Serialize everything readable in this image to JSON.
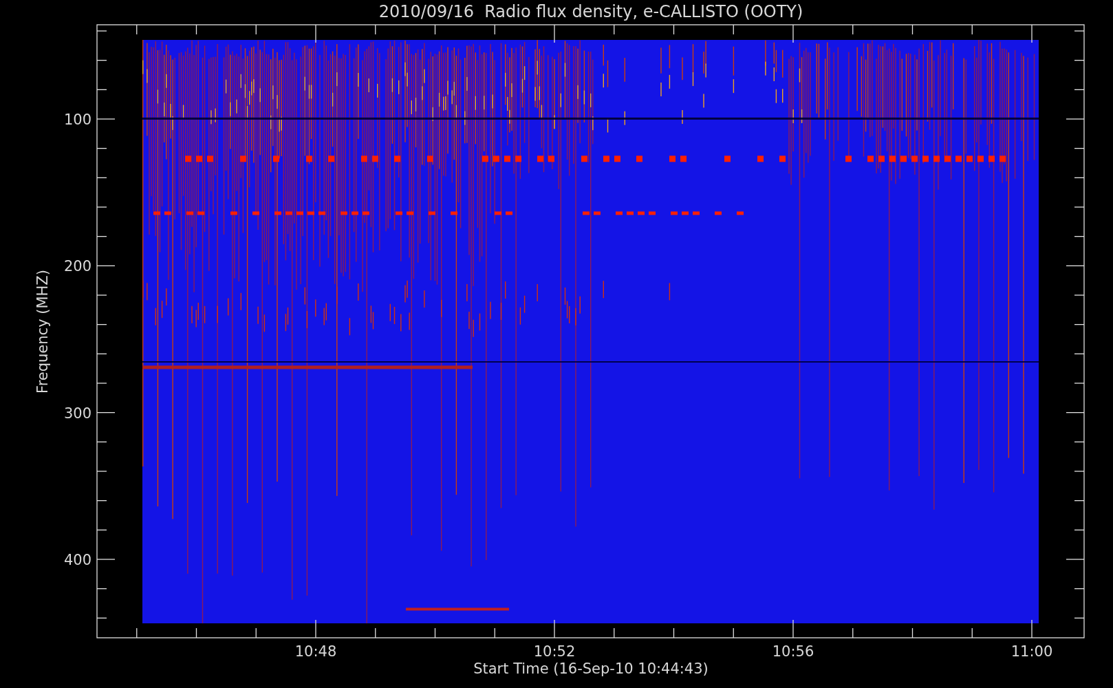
{
  "title": "2010/09/16  Radio flux density, e-CALLISTO (OOTY)",
  "y_axis": {
    "label": "Frequency (MHZ)",
    "ticks": [
      "100",
      "200",
      "300",
      "400"
    ]
  },
  "x_axis": {
    "label": "Start Time (16-Sep-10 10:44:43)",
    "ticks": [
      "10:48",
      "10:52",
      "10:56",
      "11:00"
    ]
  }
}
